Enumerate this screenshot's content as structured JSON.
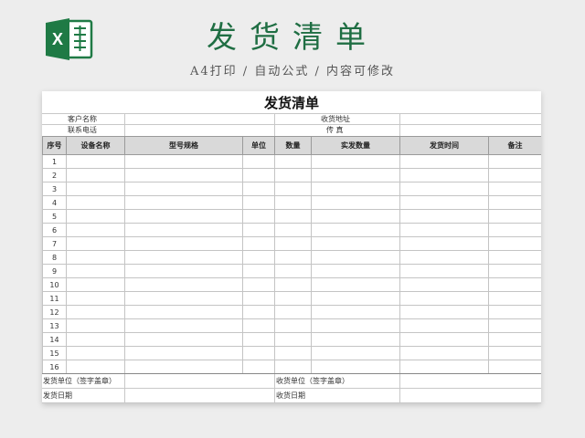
{
  "banner": {
    "title": "发货清单",
    "subtitle": "A4打印 / 自动公式 / 内容可修改",
    "logo_icon": "excel-icon",
    "logo_letter": "X",
    "accent_color": "#1f6e43"
  },
  "sheet": {
    "title": "发货清单",
    "info": {
      "customer_name_label": "客户名称",
      "ship_address_label": "收货地址",
      "phone_label": "联系电话",
      "fax_label": "传  真"
    },
    "columns": [
      "序号",
      "设备名称",
      "型号规格",
      "单位",
      "数量",
      "实发数量",
      "发货时间",
      "备注"
    ],
    "rows": [
      "1",
      "2",
      "3",
      "4",
      "5",
      "6",
      "7",
      "8",
      "9",
      "10",
      "11",
      "12",
      "13",
      "14",
      "15",
      "16"
    ],
    "footer": {
      "sender_unit": "发货单位（签字盖章）",
      "receiver_unit": "收货单位（签字盖章）",
      "ship_date": "发货日期",
      "receive_date": "收货日期"
    }
  }
}
